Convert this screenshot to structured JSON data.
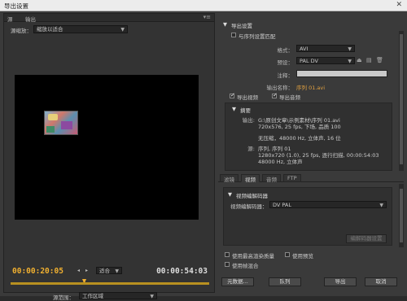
{
  "window": {
    "title": "导出设置",
    "close_icon": "close-icon"
  },
  "left": {
    "tabs": [
      "源",
      "输出"
    ],
    "source_scaling_label": "源缩放：",
    "source_scaling_value": "缩放以适合",
    "current_time": "00:00:20:05",
    "fit_value": "适合",
    "end_time": "00:00:54:03",
    "range_label": "源范围：",
    "range_value": "工作区域"
  },
  "right": {
    "export_settings_title": "导出设置",
    "match_sequence_label": "与序列设置匹配",
    "format_label": "格式：",
    "format_value": "AVI",
    "preset_label": "预设：",
    "preset_value": "PAL DV",
    "comments_label": "注释：",
    "comments_value": "",
    "output_name_label": "输出名称：",
    "output_name_value": "序列 01.avi",
    "export_video_label": "导出视频",
    "export_audio_label": "导出音频",
    "summary_title": "摘要",
    "output_label": "输出:",
    "output_line1": "G:\\原创文章\\示例素材\\序列 01.avi",
    "output_line2": "720x576, 25 fps, 下场, 品质 100",
    "output_line3": "无压缩，48000 Hz, 立体声, 16 位",
    "source_label": "源:",
    "source_line1": "序列, 序列 01",
    "source_line2": "1280x720 (1.0), 25 fps, 逐行扫描, 00:00:54:03",
    "source_line3": "48000 Hz, 立体声",
    "tabs": [
      "滤镜",
      "视频",
      "音频",
      "FTP"
    ],
    "active_tab": "视频",
    "video_codec_title": "视频编解码器",
    "video_codec_label": "视频编解码器：",
    "video_codec_value": "DV PAL",
    "codec_settings_button": "编解码器设置",
    "max_render_quality_label": "使用最高渲染质量",
    "use_preview_label": "使用预览",
    "use_frame_blending_label": "使用帧混合",
    "metadata_button": "元数据...",
    "queue_button": "队列",
    "export_button": "导出",
    "cancel_button": "取消"
  }
}
